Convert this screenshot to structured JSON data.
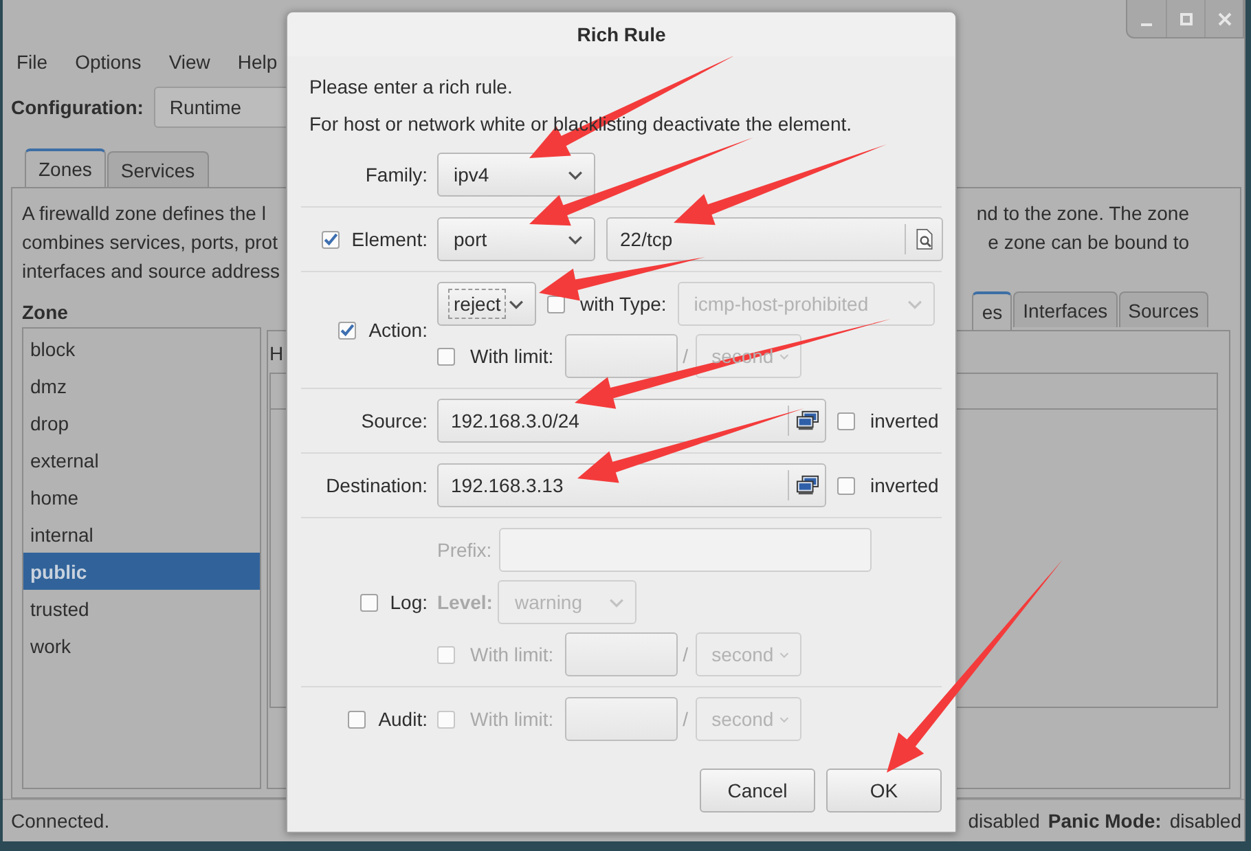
{
  "menu": [
    {
      "label": "File"
    },
    {
      "label": "Options"
    },
    {
      "label": "View"
    },
    {
      "label": "Help"
    }
  ],
  "configuration": {
    "label": "Configuration:",
    "value": "Runtime"
  },
  "tabs": [
    {
      "label": "Zones",
      "selected": true
    },
    {
      "label": "Services",
      "selected": false
    }
  ],
  "description": {
    "left_lines": [
      "A firewalld zone defines the l",
      "combines services, ports, prot",
      "interfaces and source address"
    ],
    "right_lines": [
      "nd to the zone. The zone",
      "e zone can be bound to"
    ]
  },
  "zones": {
    "title": "Zone",
    "items": [
      {
        "label": "block",
        "selected": false
      },
      {
        "label": "dmz",
        "selected": false
      },
      {
        "label": "drop",
        "selected": false
      },
      {
        "label": "external",
        "selected": false
      },
      {
        "label": "home",
        "selected": false
      },
      {
        "label": "internal",
        "selected": false
      },
      {
        "label": "public",
        "selected": true
      },
      {
        "label": "trusted",
        "selected": false
      },
      {
        "label": "work",
        "selected": false
      }
    ]
  },
  "zone_tabs": [
    {
      "label": "es",
      "selected": true
    },
    {
      "label": "Interfaces",
      "selected": false
    },
    {
      "label": "Sources",
      "selected": false
    }
  ],
  "zone_panel": {
    "label": "H"
  },
  "status_bar": {
    "text": "Connected.",
    "items": [
      {
        "value": "disabled"
      },
      {
        "label": "Panic Mode:",
        "value": "disabled"
      }
    ]
  },
  "dialog": {
    "title": "Rich Rule",
    "intro": [
      "Please enter a rich rule.",
      "For host or network white or blacklisting deactivate the element."
    ],
    "family": {
      "label": "Family:",
      "value": "ipv4"
    },
    "element": {
      "checked": true,
      "label": "Element:",
      "type": "port",
      "value": "22/tcp"
    },
    "action": {
      "checked": true,
      "label": "Action:",
      "value": "reject",
      "focused": true,
      "with_type": {
        "checked": false,
        "label": "with Type:",
        "value": "icmp-host-prohibited"
      },
      "limit": {
        "checked": false,
        "label": "With limit:",
        "separator": "/",
        "unit": "second"
      }
    },
    "source": {
      "label": "Source:",
      "value": "192.168.3.0/24",
      "inverted": {
        "checked": false,
        "label": "inverted"
      }
    },
    "destination": {
      "label": "Destination:",
      "value": "192.168.3.13",
      "inverted": {
        "checked": false,
        "label": "inverted"
      }
    },
    "log": {
      "checked": false,
      "label": "Log:",
      "prefix_label": "Prefix:",
      "level_label": "Level:",
      "level": "warning",
      "limit": {
        "checked": false,
        "label": "With limit:",
        "separator": "/",
        "unit": "second"
      }
    },
    "audit": {
      "checked": false,
      "label": "Audit:",
      "limit": {
        "checked": false,
        "label": "With limit:",
        "separator": "/",
        "unit": "second"
      }
    },
    "buttons": [
      {
        "label": "Cancel"
      },
      {
        "label": "OK"
      }
    ]
  }
}
